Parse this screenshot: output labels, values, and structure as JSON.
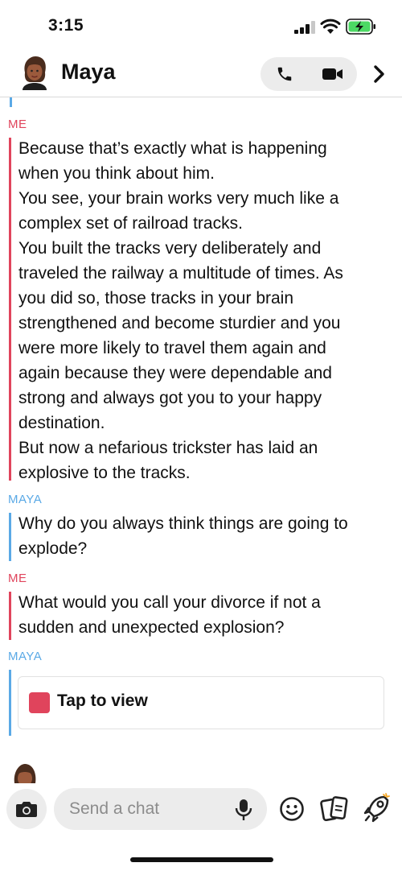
{
  "status_bar": {
    "time": "3:15"
  },
  "header": {
    "contact_name": "Maya"
  },
  "messages": [
    {
      "sender": "ME",
      "lines": [
        "Because that’s exactly what is happening",
        "when you think about him.",
        "You see, your brain works very much like a",
        "complex set of railroad tracks.",
        "You built the tracks very deliberately and",
        "traveled the railway a multitude of times. As",
        "you did so, those tracks in your brain",
        "strengthened and become sturdier and you",
        "were more likely to travel them again and",
        "again because they were dependable and",
        "strong and always got you to your happy",
        "destination.",
        "But now a nefarious trickster has laid an",
        "explosive to the tracks."
      ]
    },
    {
      "sender": "MAYA",
      "lines": [
        "Why do you always think things are going to",
        "explode?"
      ]
    },
    {
      "sender": "ME",
      "lines": [
        "What would you call your divorce if not a",
        "sudden and unexpected explosion?"
      ]
    },
    {
      "sender": "MAYA",
      "snap_label": "Tap to view"
    }
  ],
  "composer": {
    "placeholder": "Send a chat"
  },
  "colors": {
    "me": "#e0445c",
    "maya": "#5aa9e6",
    "snap": "#e0445c",
    "battery": "#4cd964"
  }
}
